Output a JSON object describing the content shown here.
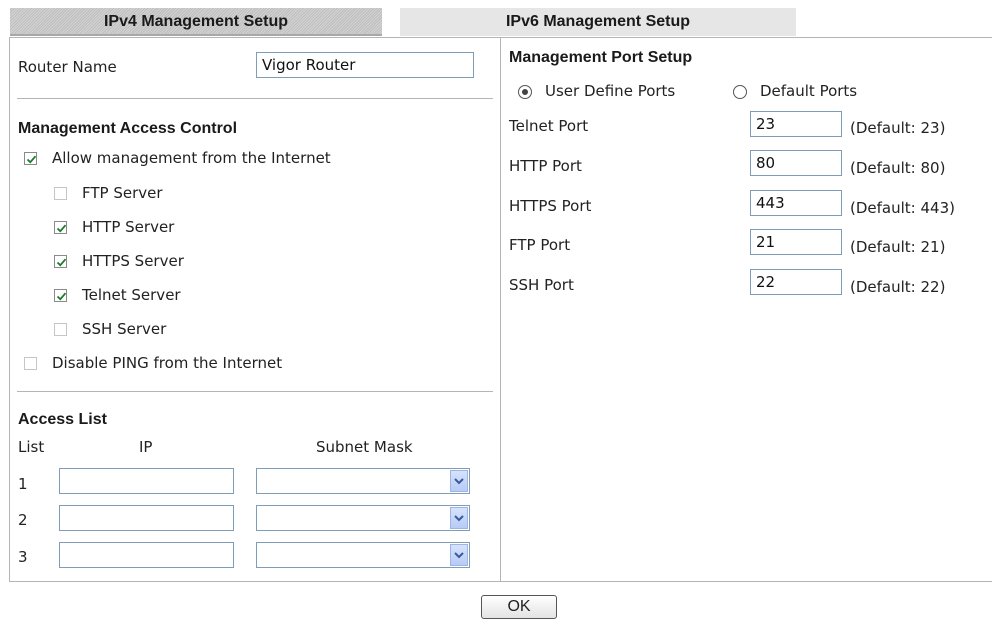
{
  "tabs": {
    "ipv4": "IPv4 Management Setup",
    "ipv6": "IPv6 Management Setup"
  },
  "router_name": {
    "label": "Router Name",
    "value": "Vigor Router"
  },
  "access_control": {
    "heading": "Management Access Control",
    "allow_internet": {
      "label": "Allow management from the Internet",
      "checked": true
    },
    "services": [
      {
        "label": "FTP Server",
        "checked": false
      },
      {
        "label": "HTTP Server",
        "checked": true
      },
      {
        "label": "HTTPS Server",
        "checked": true
      },
      {
        "label": "Telnet Server",
        "checked": true
      },
      {
        "label": "SSH Server",
        "checked": false
      }
    ],
    "disable_ping": {
      "label": "Disable PING from the Internet",
      "checked": false
    }
  },
  "access_list": {
    "heading": "Access List",
    "col_list": "List",
    "col_ip": "IP",
    "col_mask": "Subnet Mask",
    "rows": [
      {
        "num": "1",
        "ip": "",
        "mask": ""
      },
      {
        "num": "2",
        "ip": "",
        "mask": ""
      },
      {
        "num": "3",
        "ip": "",
        "mask": ""
      }
    ]
  },
  "port_setup": {
    "heading": "Management Port Setup",
    "radio_user": "User Define Ports",
    "radio_default": "Default Ports",
    "selected": "user",
    "ports": [
      {
        "label": "Telnet Port",
        "value": "23",
        "default": "(Default: 23)"
      },
      {
        "label": "HTTP Port",
        "value": "80",
        "default": "(Default: 80)"
      },
      {
        "label": "HTTPS Port",
        "value": "443",
        "default": "(Default: 443)"
      },
      {
        "label": "FTP Port",
        "value": "21",
        "default": "(Default: 21)"
      },
      {
        "label": "SSH Port",
        "value": "22",
        "default": "(Default: 22)"
      }
    ]
  },
  "ok_label": "OK",
  "colors": {
    "checkmark": "#1c7a2c",
    "border": "#b5b5b5",
    "input_border": "#7f9db9"
  }
}
